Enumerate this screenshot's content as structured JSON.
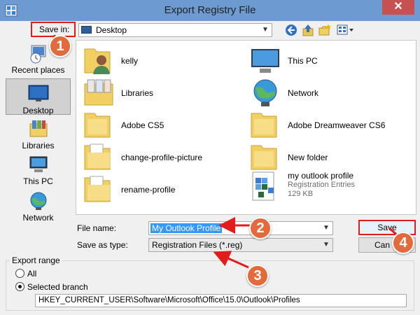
{
  "window": {
    "title": "Export Registry File",
    "close_label": "✕"
  },
  "toolbar": {
    "save_in_label": "Save in:",
    "location": "Desktop",
    "buttons": [
      "back-icon",
      "up-folder-icon",
      "new-folder-icon",
      "view-menu-icon"
    ]
  },
  "places": [
    {
      "label": "Recent places",
      "icon": "recent-places-icon",
      "selected": false
    },
    {
      "label": "Desktop",
      "icon": "desktop-icon",
      "selected": true
    },
    {
      "label": "Libraries",
      "icon": "libraries-icon",
      "selected": false
    },
    {
      "label": "This PC",
      "icon": "this-pc-icon",
      "selected": false
    },
    {
      "label": "Network",
      "icon": "network-icon",
      "selected": false
    }
  ],
  "files": [
    {
      "name": "kelly",
      "icon": "user-folder-icon"
    },
    {
      "name": "This PC",
      "icon": "this-pc-icon"
    },
    {
      "name": "Libraries",
      "icon": "libraries-icon"
    },
    {
      "name": "Network",
      "icon": "network-icon"
    },
    {
      "name": "Adobe CS5",
      "icon": "folder-icon"
    },
    {
      "name": "Adobe Dreamweaver CS6",
      "icon": "folder-icon"
    },
    {
      "name": "change-profile-picture",
      "icon": "folder-icon"
    },
    {
      "name": "New folder",
      "icon": "folder-icon"
    },
    {
      "name": "rename-profile",
      "icon": "folder-icon"
    },
    {
      "name": "my outlook profile",
      "type": "Registration Entries",
      "size": "129 KB",
      "icon": "registry-file-icon"
    }
  ],
  "form": {
    "file_name_label": "File name:",
    "file_name_value": "My Outlook Profile",
    "save_as_type_label": "Save as type:",
    "save_as_type_value": "Registration Files (*.reg)",
    "save_button": "Save",
    "cancel_button": "Can"
  },
  "export_range": {
    "legend": "Export range",
    "all_label": "All",
    "selected_label": "Selected branch",
    "selected": "selected_branch",
    "branch_path": "HKEY_CURRENT_USER\\Software\\Microsoft\\Office\\15.0\\Outlook\\Profiles"
  },
  "annotations": {
    "step1": "1",
    "step2": "2",
    "step3": "3",
    "step4": "4",
    "highlight_color": "#e21b1b",
    "badge_color": "#e26a3b"
  }
}
